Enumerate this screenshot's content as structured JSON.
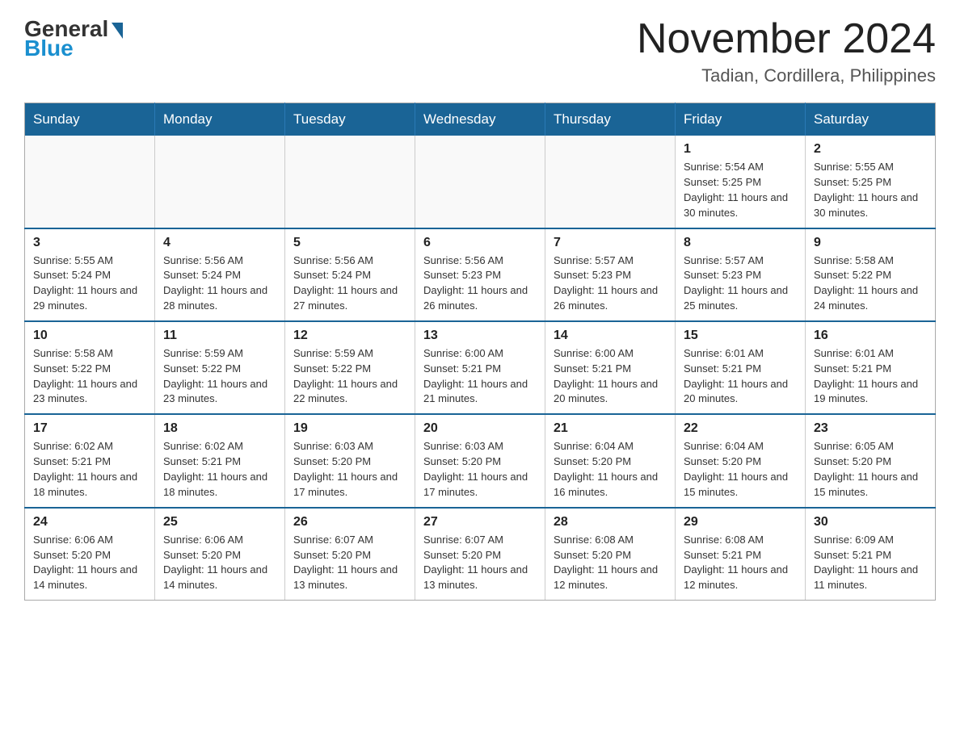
{
  "logo": {
    "general": "General",
    "blue": "Blue"
  },
  "title": {
    "month": "November 2024",
    "location": "Tadian, Cordillera, Philippines"
  },
  "weekdays": [
    "Sunday",
    "Monday",
    "Tuesday",
    "Wednesday",
    "Thursday",
    "Friday",
    "Saturday"
  ],
  "weeks": [
    [
      {
        "day": "",
        "info": ""
      },
      {
        "day": "",
        "info": ""
      },
      {
        "day": "",
        "info": ""
      },
      {
        "day": "",
        "info": ""
      },
      {
        "day": "",
        "info": ""
      },
      {
        "day": "1",
        "info": "Sunrise: 5:54 AM\nSunset: 5:25 PM\nDaylight: 11 hours and 30 minutes."
      },
      {
        "day": "2",
        "info": "Sunrise: 5:55 AM\nSunset: 5:25 PM\nDaylight: 11 hours and 30 minutes."
      }
    ],
    [
      {
        "day": "3",
        "info": "Sunrise: 5:55 AM\nSunset: 5:24 PM\nDaylight: 11 hours and 29 minutes."
      },
      {
        "day": "4",
        "info": "Sunrise: 5:56 AM\nSunset: 5:24 PM\nDaylight: 11 hours and 28 minutes."
      },
      {
        "day": "5",
        "info": "Sunrise: 5:56 AM\nSunset: 5:24 PM\nDaylight: 11 hours and 27 minutes."
      },
      {
        "day": "6",
        "info": "Sunrise: 5:56 AM\nSunset: 5:23 PM\nDaylight: 11 hours and 26 minutes."
      },
      {
        "day": "7",
        "info": "Sunrise: 5:57 AM\nSunset: 5:23 PM\nDaylight: 11 hours and 26 minutes."
      },
      {
        "day": "8",
        "info": "Sunrise: 5:57 AM\nSunset: 5:23 PM\nDaylight: 11 hours and 25 minutes."
      },
      {
        "day": "9",
        "info": "Sunrise: 5:58 AM\nSunset: 5:22 PM\nDaylight: 11 hours and 24 minutes."
      }
    ],
    [
      {
        "day": "10",
        "info": "Sunrise: 5:58 AM\nSunset: 5:22 PM\nDaylight: 11 hours and 23 minutes."
      },
      {
        "day": "11",
        "info": "Sunrise: 5:59 AM\nSunset: 5:22 PM\nDaylight: 11 hours and 23 minutes."
      },
      {
        "day": "12",
        "info": "Sunrise: 5:59 AM\nSunset: 5:22 PM\nDaylight: 11 hours and 22 minutes."
      },
      {
        "day": "13",
        "info": "Sunrise: 6:00 AM\nSunset: 5:21 PM\nDaylight: 11 hours and 21 minutes."
      },
      {
        "day": "14",
        "info": "Sunrise: 6:00 AM\nSunset: 5:21 PM\nDaylight: 11 hours and 20 minutes."
      },
      {
        "day": "15",
        "info": "Sunrise: 6:01 AM\nSunset: 5:21 PM\nDaylight: 11 hours and 20 minutes."
      },
      {
        "day": "16",
        "info": "Sunrise: 6:01 AM\nSunset: 5:21 PM\nDaylight: 11 hours and 19 minutes."
      }
    ],
    [
      {
        "day": "17",
        "info": "Sunrise: 6:02 AM\nSunset: 5:21 PM\nDaylight: 11 hours and 18 minutes."
      },
      {
        "day": "18",
        "info": "Sunrise: 6:02 AM\nSunset: 5:21 PM\nDaylight: 11 hours and 18 minutes."
      },
      {
        "day": "19",
        "info": "Sunrise: 6:03 AM\nSunset: 5:20 PM\nDaylight: 11 hours and 17 minutes."
      },
      {
        "day": "20",
        "info": "Sunrise: 6:03 AM\nSunset: 5:20 PM\nDaylight: 11 hours and 17 minutes."
      },
      {
        "day": "21",
        "info": "Sunrise: 6:04 AM\nSunset: 5:20 PM\nDaylight: 11 hours and 16 minutes."
      },
      {
        "day": "22",
        "info": "Sunrise: 6:04 AM\nSunset: 5:20 PM\nDaylight: 11 hours and 15 minutes."
      },
      {
        "day": "23",
        "info": "Sunrise: 6:05 AM\nSunset: 5:20 PM\nDaylight: 11 hours and 15 minutes."
      }
    ],
    [
      {
        "day": "24",
        "info": "Sunrise: 6:06 AM\nSunset: 5:20 PM\nDaylight: 11 hours and 14 minutes."
      },
      {
        "day": "25",
        "info": "Sunrise: 6:06 AM\nSunset: 5:20 PM\nDaylight: 11 hours and 14 minutes."
      },
      {
        "day": "26",
        "info": "Sunrise: 6:07 AM\nSunset: 5:20 PM\nDaylight: 11 hours and 13 minutes."
      },
      {
        "day": "27",
        "info": "Sunrise: 6:07 AM\nSunset: 5:20 PM\nDaylight: 11 hours and 13 minutes."
      },
      {
        "day": "28",
        "info": "Sunrise: 6:08 AM\nSunset: 5:20 PM\nDaylight: 11 hours and 12 minutes."
      },
      {
        "day": "29",
        "info": "Sunrise: 6:08 AM\nSunset: 5:21 PM\nDaylight: 11 hours and 12 minutes."
      },
      {
        "day": "30",
        "info": "Sunrise: 6:09 AM\nSunset: 5:21 PM\nDaylight: 11 hours and 11 minutes."
      }
    ]
  ]
}
